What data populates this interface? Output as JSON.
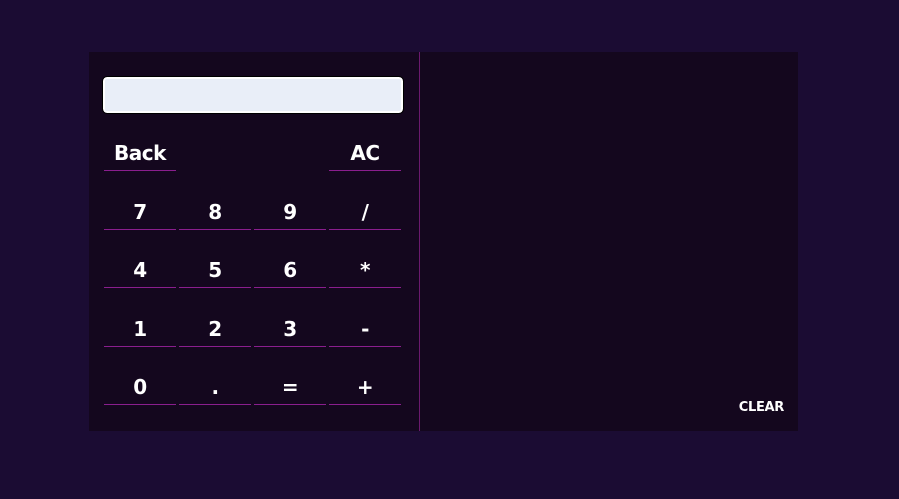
{
  "calculator": {
    "display_value": "",
    "keys": {
      "back": "Back",
      "ac": "AC",
      "k7": "7",
      "k8": "8",
      "k9": "9",
      "divide": "/",
      "k4": "4",
      "k5": "5",
      "k6": "6",
      "multiply": "*",
      "k1": "1",
      "k2": "2",
      "k3": "3",
      "minus": "-",
      "k0": "0",
      "dot": ".",
      "equals": "=",
      "plus": "+"
    }
  },
  "history": {
    "clear_label": "CLEAR"
  },
  "colors": {
    "page_background": "#1b0c33",
    "panel_background": "#14071e",
    "accent_line": "#8a1e8e",
    "display_background": "#e9eef8",
    "key_text": "#ffffff"
  }
}
